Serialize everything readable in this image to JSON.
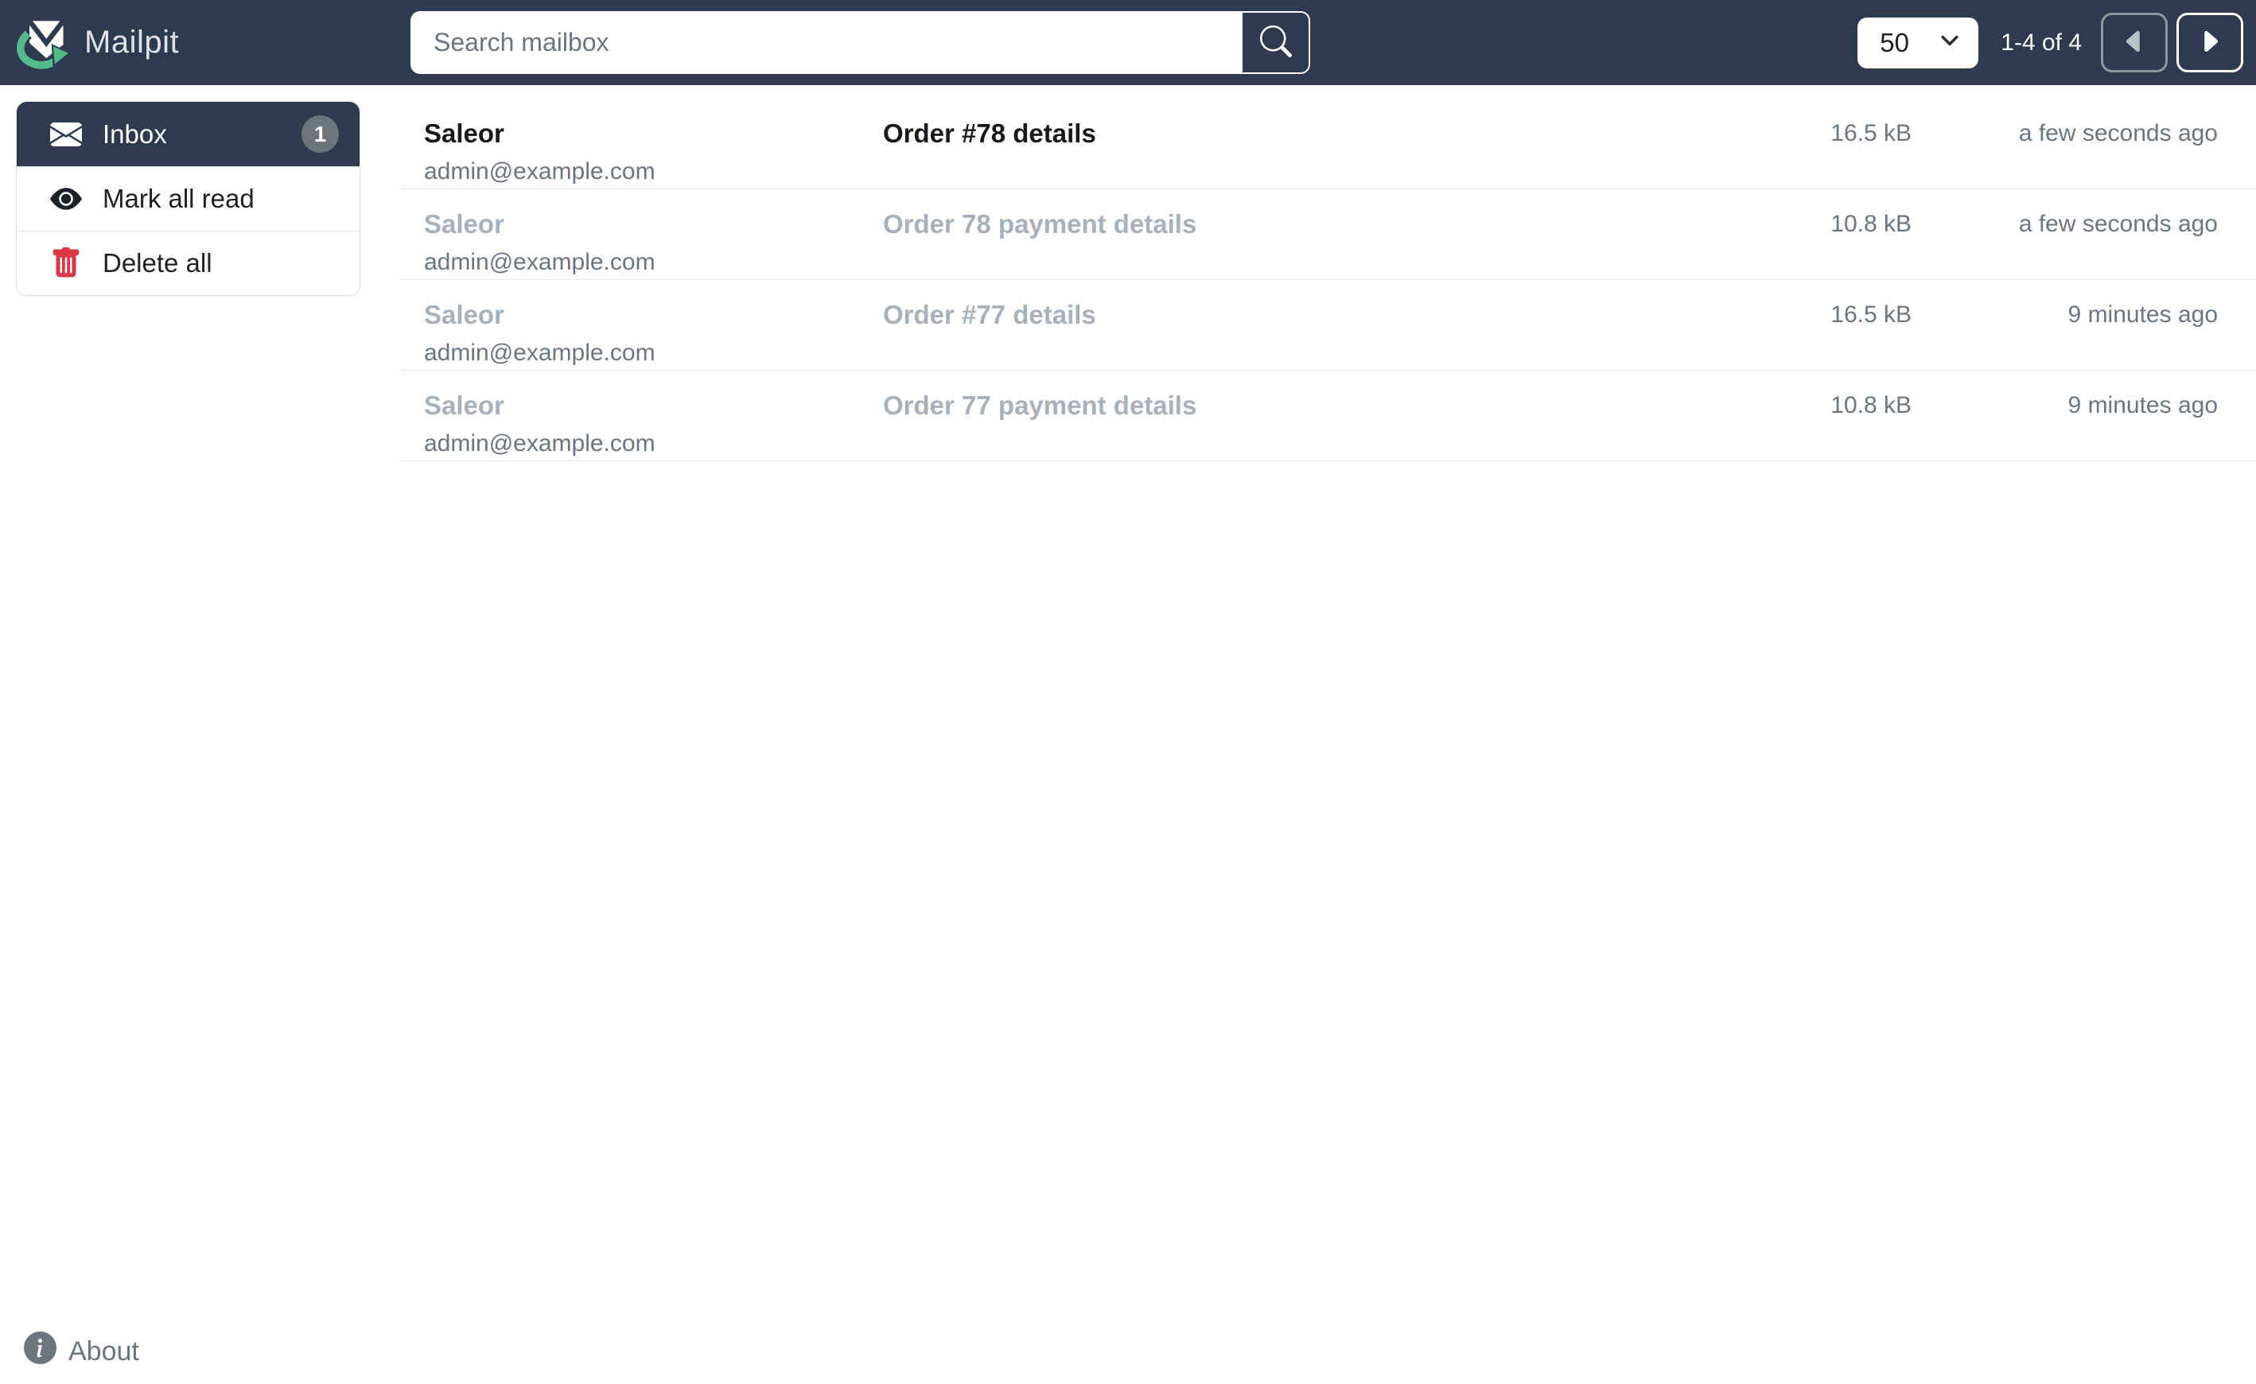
{
  "app": {
    "brand": "Mailpit"
  },
  "navbar": {
    "search": {
      "placeholder": "Search mailbox",
      "value": ""
    },
    "per_page": "50",
    "pagination": {
      "info": "1-4 of 4"
    }
  },
  "sidebar": {
    "inbox": {
      "label": "Inbox",
      "badge": "1"
    },
    "mark_all_read": {
      "label": "Mark all read"
    },
    "delete_all": {
      "label": "Delete all"
    }
  },
  "footer": {
    "about": "About"
  },
  "messages": [
    {
      "from_name": "Saleor",
      "from_email": "admin@example.com",
      "subject": "Order #78 details",
      "size": "16.5 kB",
      "date": "a few seconds ago",
      "unread": true
    },
    {
      "from_name": "Saleor",
      "from_email": "admin@example.com",
      "subject": "Order 78 payment details",
      "size": "10.8 kB",
      "date": "a few seconds ago",
      "unread": false
    },
    {
      "from_name": "Saleor",
      "from_email": "admin@example.com",
      "subject": "Order #77 details",
      "size": "16.5 kB",
      "date": "9 minutes ago",
      "unread": false
    },
    {
      "from_name": "Saleor",
      "from_email": "admin@example.com",
      "subject": "Order 77 payment details",
      "size": "10.8 kB",
      "date": "9 minutes ago",
      "unread": false
    }
  ],
  "icons": {
    "logo": "mailpit-envelope-arrow",
    "search": "magnifier",
    "inbox": "envelope-fill",
    "mark_all_read": "eye-fill",
    "delete_all": "trash-fill",
    "prev": "caret-left-fill",
    "next": "caret-right-fill",
    "per_page_caret": "chevron-down",
    "about": "info-circle-fill"
  },
  "colors": {
    "navbar_bg": "#2e3b4e",
    "brand_green": "#54b98b",
    "badge_bg": "#6c757d",
    "danger": "#dc3545",
    "muted": "#6c757d",
    "read_text": "#a8b0b9",
    "unread_text": "#17191c",
    "separator": "#e4e7ea",
    "border": "#dbe0e4"
  }
}
